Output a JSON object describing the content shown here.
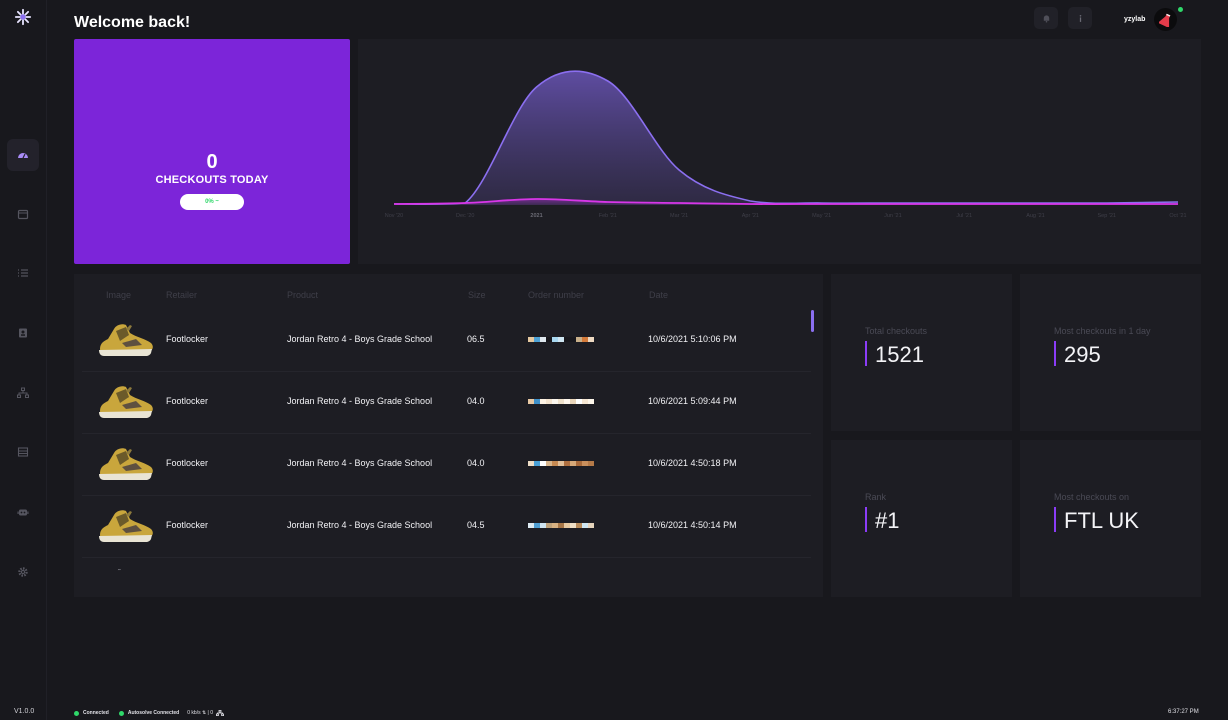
{
  "header": {
    "title": "Welcome back!",
    "username": "yzylab"
  },
  "sidebar": {
    "version": "V1.0.0",
    "items": [
      {
        "icon": "dashboard-icon",
        "active": true
      },
      {
        "icon": "calendar-icon",
        "active": false
      },
      {
        "icon": "task-list-icon",
        "active": false
      },
      {
        "icon": "profile-icon",
        "active": false
      },
      {
        "icon": "proxy-icon",
        "active": false
      },
      {
        "icon": "table-icon",
        "active": false
      },
      {
        "icon": "bot-icon",
        "active": false
      },
      {
        "icon": "settings-icon",
        "active": false
      }
    ]
  },
  "checkouts_today": {
    "count": "0",
    "label": "CHECKOUTS TODAY",
    "change": "0% ~"
  },
  "chart_data": {
    "type": "area",
    "x": [
      "Nov '20",
      "Dec '20",
      "2021",
      "Feb '21",
      "Mar '21",
      "Apr '21",
      "May '21",
      "Jun '21",
      "Jul '21",
      "Aug '21",
      "Sep '21",
      "Oct '21"
    ],
    "series": [
      {
        "color": "#8b6ff0",
        "values": [
          1,
          2,
          118,
          124,
          35,
          4,
          2,
          2,
          2,
          2,
          2,
          3
        ]
      },
      {
        "color": "#d836e8",
        "values": [
          1,
          2,
          6,
          3,
          2,
          1,
          1,
          1,
          1,
          1,
          1,
          1
        ]
      }
    ],
    "title": "",
    "xlabel": "",
    "ylabel": ""
  },
  "table": {
    "headers": [
      "Image",
      "Retailer",
      "Product",
      "Size",
      "Order number",
      "Date"
    ],
    "rows": [
      {
        "retailer": "Footlocker",
        "product": "Jordan Retro 4 - Boys Grade School",
        "size": "06.5",
        "date": "10/6/2021 5:10:06 PM"
      },
      {
        "retailer": "Footlocker",
        "product": "Jordan Retro 4 - Boys Grade School",
        "size": "04.0",
        "date": "10/6/2021 5:09:44 PM"
      },
      {
        "retailer": "Footlocker",
        "product": "Jordan Retro 4 - Boys Grade School",
        "size": "04.0",
        "date": "10/6/2021 4:50:18 PM"
      },
      {
        "retailer": "Footlocker",
        "product": "Jordan Retro 4 - Boys Grade School",
        "size": "04.5",
        "date": "10/6/2021 4:50:14 PM"
      }
    ]
  },
  "stats": {
    "total_checkouts": {
      "label": "Total checkouts",
      "value": "1521"
    },
    "most_in_day": {
      "label": "Most checkouts in 1 day",
      "value": "295"
    },
    "rank": {
      "label": "Rank",
      "value": "#1"
    },
    "most_on": {
      "label": "Most checkouts on",
      "value": "FTL UK"
    }
  },
  "status": {
    "connected": "Connected",
    "autosolve": "Autosolve Connected",
    "network": "0 kb/s ⇅ | 0",
    "clock": "6:37:27 PM"
  },
  "colors": {
    "accent": "#7c25d9",
    "card": "#1d1d23",
    "bg": "#18181d",
    "success": "#2fd86a"
  }
}
